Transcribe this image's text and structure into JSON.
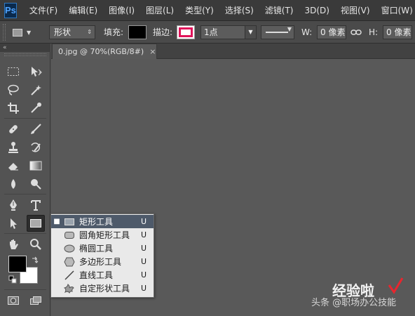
{
  "app": {
    "logo_text": "Ps"
  },
  "menu": [
    "文件(F)",
    "编辑(E)",
    "图像(I)",
    "图层(L)",
    "类型(Y)",
    "选择(S)",
    "滤镜(T)",
    "3D(D)",
    "视图(V)",
    "窗口(W)"
  ],
  "options": {
    "mode": "形状",
    "fill_label": "填充:",
    "stroke_label": "描边:",
    "stroke_width": "1点",
    "w_label": "W:",
    "w_value": "0 像素",
    "h_label": "H:",
    "h_value": "0 像素",
    "colors": {
      "fill": "#000000",
      "stroke": "#e0145a"
    }
  },
  "document": {
    "tab_title": "0.jpg @ 70%(RGB/8#)",
    "close_glyph": "×"
  },
  "flyout": {
    "items": [
      {
        "label": "矩形工具",
        "key": "U",
        "icon": "rectangle-icon",
        "active": true
      },
      {
        "label": "圆角矩形工具",
        "key": "U",
        "icon": "rounded-rectangle-icon",
        "active": false
      },
      {
        "label": "椭圆工具",
        "key": "U",
        "icon": "ellipse-icon",
        "active": false
      },
      {
        "label": "多边形工具",
        "key": "U",
        "icon": "polygon-icon",
        "active": false
      },
      {
        "label": "直线工具",
        "key": "U",
        "icon": "line-icon",
        "active": false
      },
      {
        "label": "自定形状工具",
        "key": "U",
        "icon": "custom-shape-icon",
        "active": false
      }
    ]
  },
  "toolbox": {
    "tools": [
      "marquee-icon",
      "move-icon",
      "lasso-icon",
      "magic-wand-icon",
      "crop-icon",
      "eyedropper-icon",
      "healing-brush-icon",
      "brush-icon",
      "clone-stamp-icon",
      "history-brush-icon",
      "eraser-icon",
      "gradient-icon",
      "blur-icon",
      "dodge-icon",
      "pen-icon",
      "type-icon",
      "path-selection-icon",
      "rectangle-tool-icon",
      "hand-icon",
      "zoom-icon",
      "foreground-color",
      "background-color",
      "swap-colors-icon",
      "default-colors-icon",
      "quick-mask-icon",
      "screen-mode-icon"
    ]
  },
  "watermark": {
    "brand": "经验啦",
    "sub": "头条 @职场办公技能"
  }
}
